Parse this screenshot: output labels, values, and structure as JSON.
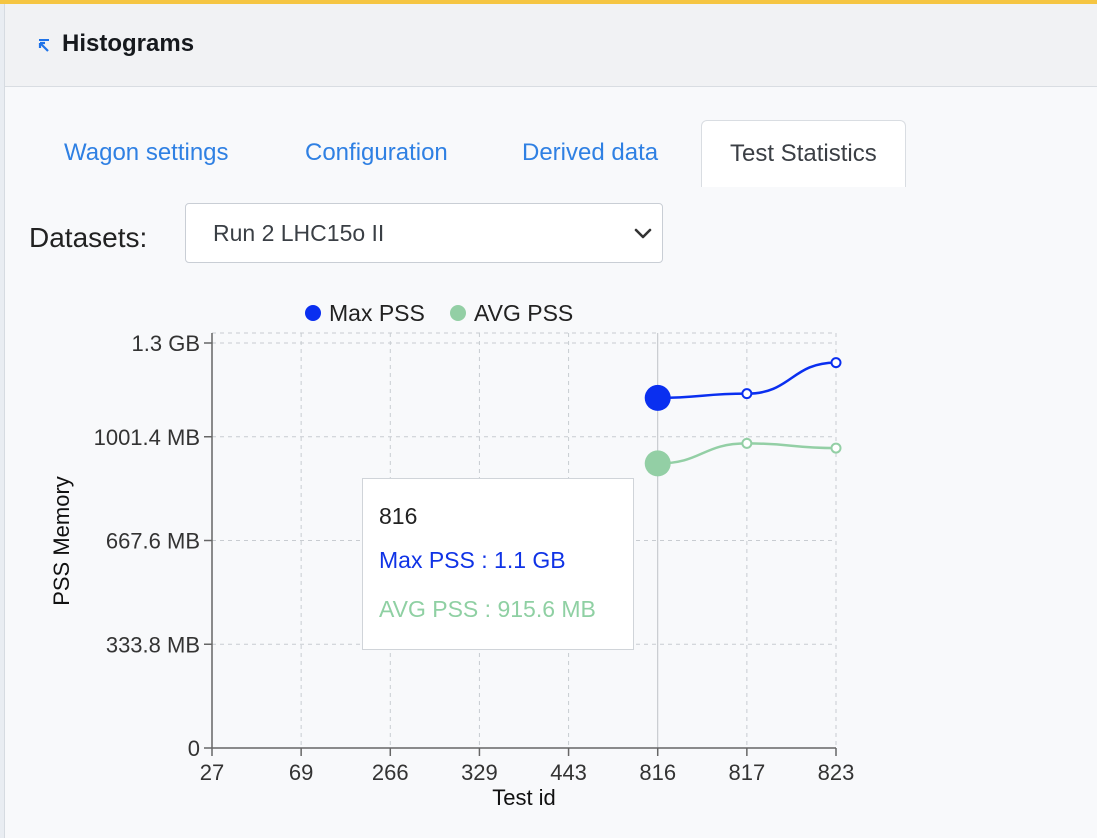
{
  "panel": {
    "title": "Histograms"
  },
  "tabs": [
    {
      "label": "Wagon settings",
      "active": false
    },
    {
      "label": "Configuration",
      "active": false
    },
    {
      "label": "Derived data",
      "active": false
    },
    {
      "label": "Test Statistics",
      "active": true
    }
  ],
  "datasets": {
    "label": "Datasets:",
    "selected": "Run 2 LHC15o II"
  },
  "colors": {
    "max_pss": "#0a2ff0",
    "avg_pss": "#93cfa5",
    "link": "#2f80e3"
  },
  "chart_data": {
    "type": "line",
    "categories": [
      "27",
      "69",
      "266",
      "329",
      "443",
      "816",
      "817",
      "823"
    ],
    "x_tick_labels": [
      "27",
      "69",
      "266",
      "329",
      "443",
      "816",
      "817",
      "823"
    ],
    "y_tick_labels": [
      "0",
      "333.8 MB",
      "667.6 MB",
      "1001.4 MB",
      "1.3 GB"
    ],
    "ylim_mb": [
      0,
      1335.2
    ],
    "xlabel": "Test id",
    "ylabel": "PSS Memory",
    "legend_position": "top",
    "grid": true,
    "series": [
      {
        "name": "Max PSS",
        "values_mb": [
          null,
          null,
          null,
          null,
          null,
          1126.4,
          1140,
          1240
        ]
      },
      {
        "name": "AVG PSS",
        "values_mb": [
          null,
          null,
          null,
          null,
          null,
          915.6,
          980,
          965
        ]
      }
    ],
    "highlighted_index": 5,
    "tooltip": {
      "title": "816",
      "max_line": "Max PSS : 1.1 GB",
      "avg_line": "AVG PSS : 915.6 MB"
    }
  }
}
